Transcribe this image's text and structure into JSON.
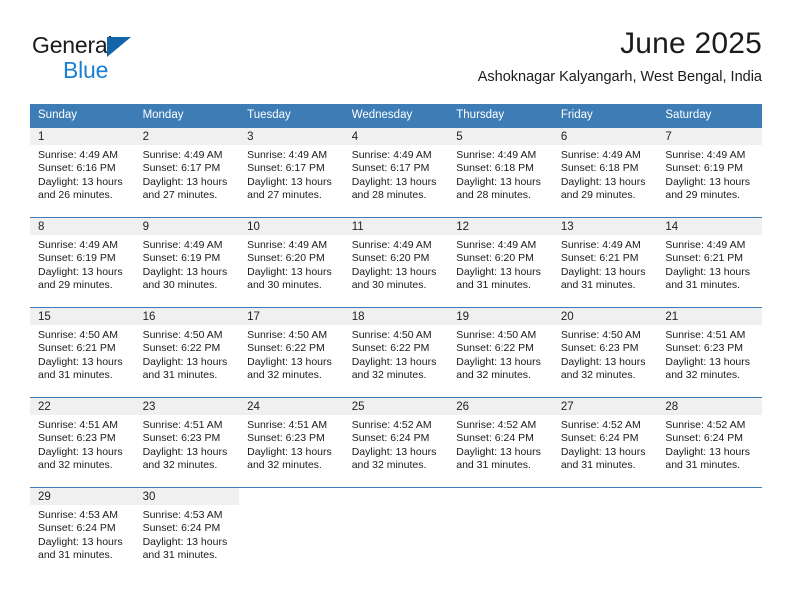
{
  "brand": {
    "name_top": "General",
    "name_bottom": "Blue"
  },
  "header": {
    "month_title": "June 2025",
    "location": "Ashoknagar Kalyangarh, West Bengal, India"
  },
  "theme": {
    "header_blue": "#3d7cb5",
    "day_band_gray": "#f0f0f0",
    "logo_blue": "#1b7fd4",
    "logo_triangle_blue": "#1464aa",
    "text_dark": "#1b1b1b"
  },
  "weekdays": [
    "Sunday",
    "Monday",
    "Tuesday",
    "Wednesday",
    "Thursday",
    "Friday",
    "Saturday"
  ],
  "labels": {
    "sunrise_prefix": "Sunrise:",
    "sunset_prefix": "Sunset:",
    "daylight_prefix": "Daylight:"
  },
  "weeks": [
    [
      {
        "day": "1",
        "sunrise": "Sunrise: 4:49 AM",
        "sunset": "Sunset: 6:16 PM",
        "daylight": "Daylight: 13 hours and 26 minutes."
      },
      {
        "day": "2",
        "sunrise": "Sunrise: 4:49 AM",
        "sunset": "Sunset: 6:17 PM",
        "daylight": "Daylight: 13 hours and 27 minutes."
      },
      {
        "day": "3",
        "sunrise": "Sunrise: 4:49 AM",
        "sunset": "Sunset: 6:17 PM",
        "daylight": "Daylight: 13 hours and 27 minutes."
      },
      {
        "day": "4",
        "sunrise": "Sunrise: 4:49 AM",
        "sunset": "Sunset: 6:17 PM",
        "daylight": "Daylight: 13 hours and 28 minutes."
      },
      {
        "day": "5",
        "sunrise": "Sunrise: 4:49 AM",
        "sunset": "Sunset: 6:18 PM",
        "daylight": "Daylight: 13 hours and 28 minutes."
      },
      {
        "day": "6",
        "sunrise": "Sunrise: 4:49 AM",
        "sunset": "Sunset: 6:18 PM",
        "daylight": "Daylight: 13 hours and 29 minutes."
      },
      {
        "day": "7",
        "sunrise": "Sunrise: 4:49 AM",
        "sunset": "Sunset: 6:19 PM",
        "daylight": "Daylight: 13 hours and 29 minutes."
      }
    ],
    [
      {
        "day": "8",
        "sunrise": "Sunrise: 4:49 AM",
        "sunset": "Sunset: 6:19 PM",
        "daylight": "Daylight: 13 hours and 29 minutes."
      },
      {
        "day": "9",
        "sunrise": "Sunrise: 4:49 AM",
        "sunset": "Sunset: 6:19 PM",
        "daylight": "Daylight: 13 hours and 30 minutes."
      },
      {
        "day": "10",
        "sunrise": "Sunrise: 4:49 AM",
        "sunset": "Sunset: 6:20 PM",
        "daylight": "Daylight: 13 hours and 30 minutes."
      },
      {
        "day": "11",
        "sunrise": "Sunrise: 4:49 AM",
        "sunset": "Sunset: 6:20 PM",
        "daylight": "Daylight: 13 hours and 30 minutes."
      },
      {
        "day": "12",
        "sunrise": "Sunrise: 4:49 AM",
        "sunset": "Sunset: 6:20 PM",
        "daylight": "Daylight: 13 hours and 31 minutes."
      },
      {
        "day": "13",
        "sunrise": "Sunrise: 4:49 AM",
        "sunset": "Sunset: 6:21 PM",
        "daylight": "Daylight: 13 hours and 31 minutes."
      },
      {
        "day": "14",
        "sunrise": "Sunrise: 4:49 AM",
        "sunset": "Sunset: 6:21 PM",
        "daylight": "Daylight: 13 hours and 31 minutes."
      }
    ],
    [
      {
        "day": "15",
        "sunrise": "Sunrise: 4:50 AM",
        "sunset": "Sunset: 6:21 PM",
        "daylight": "Daylight: 13 hours and 31 minutes."
      },
      {
        "day": "16",
        "sunrise": "Sunrise: 4:50 AM",
        "sunset": "Sunset: 6:22 PM",
        "daylight": "Daylight: 13 hours and 31 minutes."
      },
      {
        "day": "17",
        "sunrise": "Sunrise: 4:50 AM",
        "sunset": "Sunset: 6:22 PM",
        "daylight": "Daylight: 13 hours and 32 minutes."
      },
      {
        "day": "18",
        "sunrise": "Sunrise: 4:50 AM",
        "sunset": "Sunset: 6:22 PM",
        "daylight": "Daylight: 13 hours and 32 minutes."
      },
      {
        "day": "19",
        "sunrise": "Sunrise: 4:50 AM",
        "sunset": "Sunset: 6:22 PM",
        "daylight": "Daylight: 13 hours and 32 minutes."
      },
      {
        "day": "20",
        "sunrise": "Sunrise: 4:50 AM",
        "sunset": "Sunset: 6:23 PM",
        "daylight": "Daylight: 13 hours and 32 minutes."
      },
      {
        "day": "21",
        "sunrise": "Sunrise: 4:51 AM",
        "sunset": "Sunset: 6:23 PM",
        "daylight": "Daylight: 13 hours and 32 minutes."
      }
    ],
    [
      {
        "day": "22",
        "sunrise": "Sunrise: 4:51 AM",
        "sunset": "Sunset: 6:23 PM",
        "daylight": "Daylight: 13 hours and 32 minutes."
      },
      {
        "day": "23",
        "sunrise": "Sunrise: 4:51 AM",
        "sunset": "Sunset: 6:23 PM",
        "daylight": "Daylight: 13 hours and 32 minutes."
      },
      {
        "day": "24",
        "sunrise": "Sunrise: 4:51 AM",
        "sunset": "Sunset: 6:23 PM",
        "daylight": "Daylight: 13 hours and 32 minutes."
      },
      {
        "day": "25",
        "sunrise": "Sunrise: 4:52 AM",
        "sunset": "Sunset: 6:24 PM",
        "daylight": "Daylight: 13 hours and 32 minutes."
      },
      {
        "day": "26",
        "sunrise": "Sunrise: 4:52 AM",
        "sunset": "Sunset: 6:24 PM",
        "daylight": "Daylight: 13 hours and 31 minutes."
      },
      {
        "day": "27",
        "sunrise": "Sunrise: 4:52 AM",
        "sunset": "Sunset: 6:24 PM",
        "daylight": "Daylight: 13 hours and 31 minutes."
      },
      {
        "day": "28",
        "sunrise": "Sunrise: 4:52 AM",
        "sunset": "Sunset: 6:24 PM",
        "daylight": "Daylight: 13 hours and 31 minutes."
      }
    ],
    [
      {
        "day": "29",
        "sunrise": "Sunrise: 4:53 AM",
        "sunset": "Sunset: 6:24 PM",
        "daylight": "Daylight: 13 hours and 31 minutes."
      },
      {
        "day": "30",
        "sunrise": "Sunrise: 4:53 AM",
        "sunset": "Sunset: 6:24 PM",
        "daylight": "Daylight: 13 hours and 31 minutes."
      },
      {
        "day": "",
        "sunrise": "",
        "sunset": "",
        "daylight": ""
      },
      {
        "day": "",
        "sunrise": "",
        "sunset": "",
        "daylight": ""
      },
      {
        "day": "",
        "sunrise": "",
        "sunset": "",
        "daylight": ""
      },
      {
        "day": "",
        "sunrise": "",
        "sunset": "",
        "daylight": ""
      },
      {
        "day": "",
        "sunrise": "",
        "sunset": "",
        "daylight": ""
      }
    ]
  ]
}
